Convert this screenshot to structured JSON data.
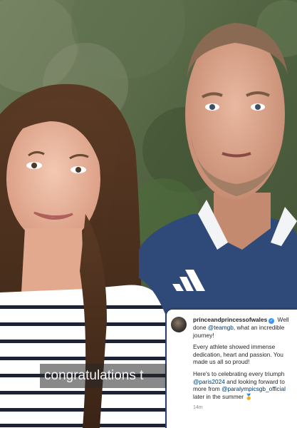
{
  "video": {
    "caption_text": "congratulations t"
  },
  "instagram_post": {
    "username": "princeandprincessofwales",
    "verified_mark": "✓",
    "line1_a": "Well done ",
    "mention_teamgb": "@teamgb",
    "line1_b": ", what an incredible journey!",
    "para2": "Every athlete showed immense dedication, heart and passion. You made us all so proud!",
    "para3_a": "Here's to celebrating every triumph ",
    "mention_paris": "@paris2024",
    "para3_b": " and looking forward to more from ",
    "mention_paralympics": "@paralympicsgb_official",
    "para3_c": " later in the summer ",
    "emoji": "🏅",
    "timestamp": "14m"
  }
}
